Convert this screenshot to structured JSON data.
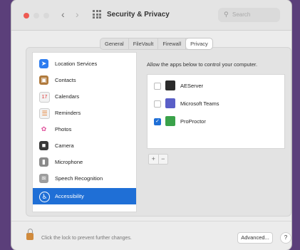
{
  "window": {
    "title": "Security & Privacy",
    "nav_back": "‹",
    "nav_forward": "›",
    "search_placeholder": "Search",
    "search_icon": "magnifier-icon",
    "colors": {
      "accent": "#1f6fd6",
      "close_light": "#ee5a52"
    }
  },
  "tabs": [
    {
      "label": "General"
    },
    {
      "label": "FileVault"
    },
    {
      "label": "Firewall"
    },
    {
      "label": "Privacy",
      "active": true
    }
  ],
  "sidebar": {
    "items": [
      {
        "label": "Location Services",
        "icon": "location-arrow-icon",
        "color": "#2c7cf0",
        "glyph": "➤"
      },
      {
        "label": "Contacts",
        "icon": "contacts-icon",
        "color": "#b07a3c",
        "glyph": "▣"
      },
      {
        "label": "Calendars",
        "icon": "calendar-icon",
        "color": "#f2f2f2",
        "glyph": "17"
      },
      {
        "label": "Reminders",
        "icon": "reminders-icon",
        "color": "#f2f2f2",
        "glyph": "☰"
      },
      {
        "label": "Photos",
        "icon": "photos-icon",
        "color": "#f0b429",
        "glyph": "✿"
      },
      {
        "label": "Camera",
        "icon": "camera-icon",
        "color": "#3a3a3a",
        "glyph": "■"
      },
      {
        "label": "Microphone",
        "icon": "microphone-icon",
        "color": "#8a8a8a",
        "glyph": "▮"
      },
      {
        "label": "Speech Recognition",
        "icon": "speech-icon",
        "color": "#9e9e9e",
        "glyph": "≋"
      },
      {
        "label": "Accessibility",
        "icon": "accessibility-icon",
        "color": "#1f6fd6",
        "glyph": "♿",
        "selected": true
      }
    ]
  },
  "main": {
    "instruction": "Allow the apps below to control your computer.",
    "apps": [
      {
        "label": "AEServer",
        "checked": false,
        "icon": "aeserver-icon",
        "color": "#2b2b2b"
      },
      {
        "label": "Microsoft Teams",
        "checked": false,
        "icon": "teams-icon",
        "color": "#5a5fc7"
      },
      {
        "label": "ProProctor",
        "checked": true,
        "icon": "proproctor-icon",
        "color": "#3aa24a"
      }
    ],
    "add_label": "+",
    "remove_label": "−"
  },
  "footer": {
    "lock_text": "Click the lock to prevent further changes.",
    "advanced_label": "Advanced...",
    "help_label": "?"
  }
}
